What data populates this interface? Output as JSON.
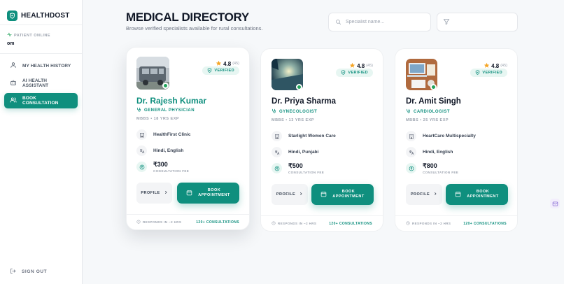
{
  "brand": {
    "name": "HEALTHDOST",
    "logo_icon": "shield-heart-icon"
  },
  "patient": {
    "status_label": "PATIENT ONLINE",
    "name": "om"
  },
  "nav": {
    "items": [
      {
        "label": "MY HEALTH HISTORY",
        "icon": "user-icon",
        "active": false
      },
      {
        "label": "AI HEALTH ASSISTANT",
        "icon": "robot-icon",
        "active": false
      },
      {
        "label": "BOOK CONSULTATION",
        "icon": "users-icon",
        "active": true
      }
    ],
    "signout_label": "SIGN OUT"
  },
  "header": {
    "title": "MEDICAL DIRECTORY",
    "subtitle": "Browse verified specialists available for rural consultations."
  },
  "search": {
    "placeholder": "Specialist name...",
    "value": ""
  },
  "colors": {
    "accent": "#0f8f7e",
    "accent_light": "#e7f6f2",
    "online": "#22a35a",
    "star": "#f5a524"
  },
  "doctors": [
    {
      "name": "Dr. Rajesh Kumar",
      "specialty": "GENERAL PHYSICIAN",
      "credentials": "MBBS • 18 YRS EXP",
      "rating": "4.8",
      "rating_count": "(45)",
      "verified_label": "VERIFIED",
      "clinic": "HealthFirst Clinic",
      "languages": "Hindi, English",
      "fee": "₹300",
      "fee_label": "CONSULTATION FEE",
      "profile_label": "PROFILE",
      "book_label_1": "BOOK",
      "book_label_2": "APPOINTMENT",
      "response": "RESPONDS IN ~2 HRS",
      "consultations": "120+ CONSULTATIONS"
    },
    {
      "name": "Dr. Priya Sharma",
      "specialty": "GYNECOLOGIST",
      "credentials": "MBBS • 13 YRS EXP",
      "rating": "4.8",
      "rating_count": "(45)",
      "verified_label": "VERIFIED",
      "clinic": "Starlight Women Care",
      "languages": "Hindi, Punjabi",
      "fee": "₹500",
      "fee_label": "CONSULTATION FEE",
      "profile_label": "PROFILE",
      "book_label_1": "BOOK",
      "book_label_2": "APPOINTMENT",
      "response": "RESPONDS IN ~2 HRS",
      "consultations": "120+ CONSULTATIONS"
    },
    {
      "name": "Dr. Amit Singh",
      "specialty": "CARDIOLOGIST",
      "credentials": "MBBS • 25 YRS EXP",
      "rating": "4.8",
      "rating_count": "(45)",
      "verified_label": "VERIFIED",
      "clinic": "HeartCare Multispecialty",
      "languages": "Hindi, English",
      "fee": "₹800",
      "fee_label": "CONSULTATION FEE",
      "profile_label": "PROFILE",
      "book_label_1": "BOOK",
      "book_label_2": "APPOINTMENT",
      "response": "RESPONDS IN ~2 HRS",
      "consultations": "120+ CONSULTATIONS"
    }
  ]
}
